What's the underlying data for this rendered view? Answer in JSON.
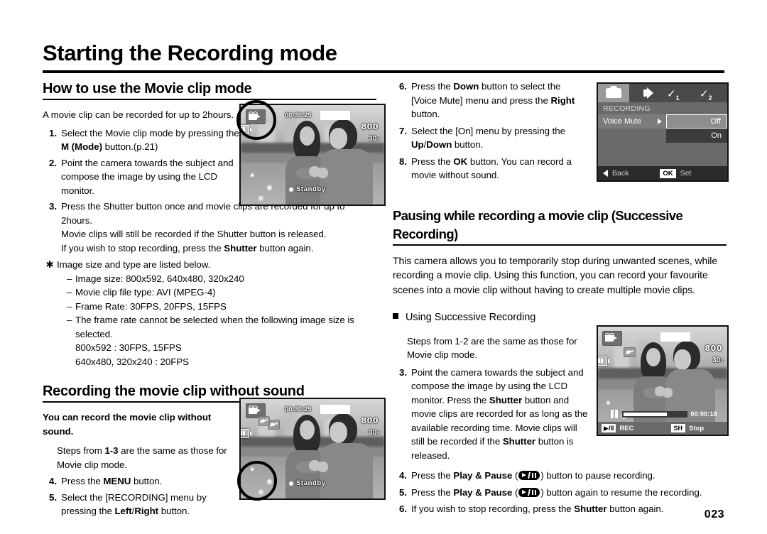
{
  "page": {
    "title": "Starting the Recording mode",
    "number": "023"
  },
  "left": {
    "section1": {
      "heading": "How to use the Movie clip mode",
      "intro": "A movie clip can be recorded for up to 2hours.",
      "steps": [
        {
          "num": "1.",
          "parts": [
            {
              "t": "Select the Movie clip mode by pressing the ",
              "b": false
            },
            {
              "t": "M (Mode)",
              "b": true
            },
            {
              "t": " button.(p.21)",
              "b": false
            }
          ]
        },
        {
          "num": "2.",
          "parts": [
            {
              "t": "Point the camera towards the subject and compose the image by using the LCD monitor.",
              "b": false
            }
          ]
        },
        {
          "num": "3.",
          "parts": [
            {
              "t": "Press the Shutter button once and movie clips are recorded for up to 2hours. Movie clips will still be recorded if the Shutter button is released. If you wish to stop recording, press the ",
              "b": false
            },
            {
              "t": "Shutter",
              "b": true
            },
            {
              "t": " button again.",
              "b": false
            }
          ]
        }
      ],
      "note_symbol": "✳",
      "note_lead": "Image size and type are listed below.",
      "note_items": [
        "Image size: 800x592, 640x480, 320x240",
        "Movie clip file type: AVI (MPEG-4)",
        "Frame Rate: 30FPS, 20FPS, 15FPS",
        "The frame rate cannot be selected when the following image size is selected."
      ],
      "note_extra": [
        "800x592 : 30FPS, 15FPS",
        "640x480, 320x240 : 20FPS"
      ]
    },
    "section2": {
      "heading": "Recording the movie clip without sound",
      "intro": "You can record the movie clip without sound.",
      "steps_intro_parts": [
        {
          "t": "Steps from ",
          "b": false
        },
        {
          "t": "1-3",
          "b": true
        },
        {
          "t": " are the same as those for Movie clip mode.",
          "b": false
        }
      ],
      "steps": [
        {
          "num": "4.",
          "parts": [
            {
              "t": "Press the ",
              "b": false
            },
            {
              "t": "MENU",
              "b": true
            },
            {
              "t": " button.",
              "b": false
            }
          ]
        },
        {
          "num": "5.",
          "parts": [
            {
              "t": "Select the [RECORDING] menu by pressing the ",
              "b": false
            },
            {
              "t": "Left",
              "b": true
            },
            {
              "t": "/",
              "b": false
            },
            {
              "t": "Right",
              "b": true
            },
            {
              "t": " button.",
              "b": false
            }
          ]
        }
      ]
    }
  },
  "right": {
    "steps_top": [
      {
        "num": "6.",
        "parts": [
          {
            "t": "Press the ",
            "b": false
          },
          {
            "t": "Down",
            "b": true
          },
          {
            "t": " button to select the [Voice Mute] menu and press the ",
            "b": false
          },
          {
            "t": "Right",
            "b": true
          },
          {
            "t": " button.",
            "b": false
          }
        ]
      },
      {
        "num": "7.",
        "parts": [
          {
            "t": "Select the [On] menu by pressing the ",
            "b": false
          },
          {
            "t": "Up",
            "b": true
          },
          {
            "t": "/",
            "b": false
          },
          {
            "t": "Down",
            "b": true
          },
          {
            "t": " button.",
            "b": false
          }
        ]
      },
      {
        "num": "8.",
        "parts": [
          {
            "t": "Press the ",
            "b": false
          },
          {
            "t": "OK",
            "b": true
          },
          {
            "t": " button. You can record a movie without sound.",
            "b": false
          }
        ]
      }
    ],
    "section3": {
      "heading": "Pausing while recording a movie clip (Successive Recording)",
      "intro": "This camera allows you to temporarily stop during unwanted scenes, while recording a movie clip. Using this function, you can record your favourite scenes into a movie clip without having to create multiple movie clips.",
      "subhead": "Using Successive Recording",
      "steps_intro": "Steps from 1-2 are the same as those for Movie clip mode.",
      "step3": {
        "num": "3.",
        "parts": [
          {
            "t": "Point the camera towards the subject and compose the image by using the LCD monitor. Press the ",
            "b": false
          },
          {
            "t": "Shutter",
            "b": true
          },
          {
            "t": " button and movie clips are recorded for as long as the available recording time. Movie clips will still be recorded if the ",
            "b": false
          },
          {
            "t": "Shutter",
            "b": true
          },
          {
            "t": " button is released.",
            "b": false
          }
        ]
      },
      "steps_bottom": [
        {
          "num": "4.",
          "pre_parts": [
            {
              "t": "Press the ",
              "b": false
            },
            {
              "t": "Play & Pause",
              "b": true
            },
            {
              "t": " (",
              "b": false
            }
          ],
          "post_parts": [
            {
              "t": ") button to pause recording.",
              "b": false
            }
          ],
          "icon": "play-pause-icon"
        },
        {
          "num": "5.",
          "pre_parts": [
            {
              "t": "Press the ",
              "b": false
            },
            {
              "t": "Play & Pause",
              "b": true
            },
            {
              "t": " (",
              "b": false
            }
          ],
          "post_parts": [
            {
              "t": ") button again to resume the recording.",
              "b": false
            }
          ],
          "icon": "play-pause-icon"
        },
        {
          "num": "6.",
          "pre_parts": [
            {
              "t": "If you wish to stop recording, press the ",
              "b": false
            },
            {
              "t": "Shutter",
              "b": true
            },
            {
              "t": " button again.",
              "b": false
            }
          ],
          "post_parts": [],
          "icon": ""
        }
      ]
    }
  },
  "lcd1": {
    "timecode": "00:30:25",
    "resolution": "800",
    "fps": "30",
    "status": "Standby",
    "icons": [
      "movie-clip-icon",
      "battery-icon"
    ]
  },
  "lcd2": {
    "timecode": "00:30:25",
    "resolution": "800",
    "fps": "30",
    "status": "Standby",
    "icons": [
      "movie-clip-icon",
      "voice-mute-icon",
      "battery-icon"
    ]
  },
  "lcd3": {
    "timecode": "00:00:18",
    "resolution": "800",
    "fps": "30",
    "rec_label": "REC",
    "rec_button": "▶/II",
    "stop_badge": "SH",
    "stop_label": "Stop",
    "icons": [
      "movie-clip-icon",
      "voice-mute-icon",
      "battery-icon",
      "pause-icon"
    ]
  },
  "menu": {
    "tabs": [
      "camera-tab",
      "sound-tab",
      "setup1-tab",
      "setup2-tab"
    ],
    "header": "RECORDING",
    "row_label": "Voice Mute",
    "options": [
      {
        "label": "Off",
        "selected": true
      },
      {
        "label": "On",
        "selected": false
      }
    ],
    "footer": {
      "back": "Back",
      "ok_badge": "OK",
      "set": "Set"
    }
  }
}
